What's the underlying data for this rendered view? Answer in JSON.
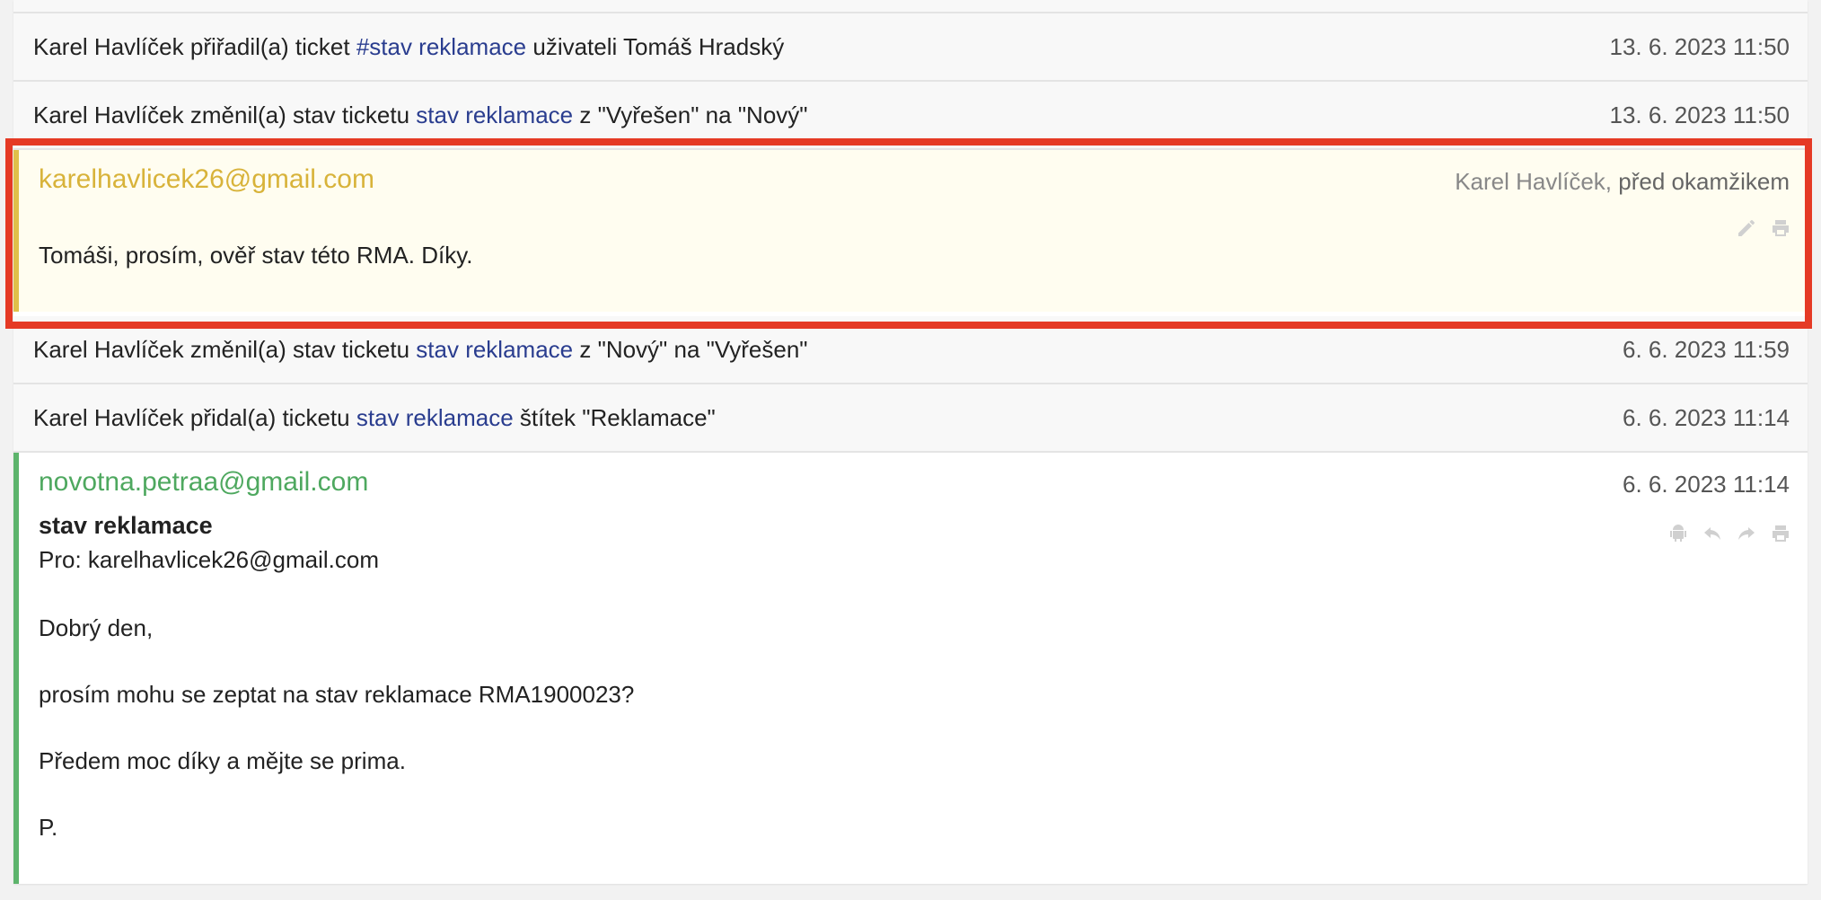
{
  "events": [
    {
      "actor": "Karel Havlíček",
      "before": "přiřadil(a) ticket",
      "link": "#stav reklamace",
      "after": "uživateli Tomáš Hradský",
      "time": "13. 6. 2023 11:50"
    },
    {
      "actor": "Karel Havlíček",
      "before": "změnil(a) stav ticketu",
      "link": "stav reklamace",
      "after": "z \"Vyřešen\" na \"Nový\"",
      "time": "13. 6. 2023 11:50"
    },
    {
      "actor": "Karel Havlíček",
      "before": "změnil(a) stav ticketu",
      "link": "stav reklamace",
      "after": "z \"Nový\" na \"Vyřešen\"",
      "time": "6. 6. 2023 11:59"
    },
    {
      "actor": "Karel Havlíček",
      "before": "přidal(a) ticketu",
      "link": "stav reklamace",
      "after": "štítek \"Reklamace\"",
      "time": "6. 6. 2023 11:14"
    }
  ],
  "note": {
    "from": "karelhavlicek26@gmail.com",
    "author": "Karel Havlíček,",
    "ago": "před okamžikem",
    "body": "Tomáši, prosím, ověř stav této RMA. Díky."
  },
  "email": {
    "from": "novotna.petraa@gmail.com",
    "time": "6. 6. 2023 11:14",
    "subject": "stav reklamace",
    "to": "Pro: karelhavlicek26@gmail.com",
    "paragraphs": [
      "Dobrý den,",
      "prosím mohu se zeptat na stav reklamace RMA1900023?",
      "Předem moc díky a mějte se prima.",
      "P."
    ]
  },
  "colors": {
    "highlight": "#e53a25",
    "note_accent": "#e0c04a",
    "email_accent": "#5db46c",
    "link": "#2a3d8f"
  }
}
